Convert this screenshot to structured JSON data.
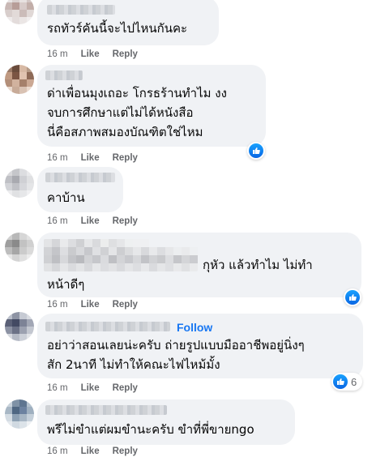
{
  "comments": [
    {
      "lines": [
        "รถทัวร์คันนี้จะไปไหนกันคะ"
      ],
      "time": "16 m",
      "like": "Like",
      "reply": "Reply"
    },
    {
      "lines": [
        "ด่าเพื่อนมุงเถอะ โกรธร้านทำไม งง",
        "จบการศึกษาแต่ไม่ได้หนังสือ",
        "นี่คือสภาพสมองบัณฑิตใช่ไหม"
      ],
      "time": "16 m",
      "like": "Like",
      "reply": "Reply",
      "reaction": {
        "icon": "like-icon"
      }
    },
    {
      "lines": [
        "คาบ้าน"
      ],
      "time": "16 m",
      "like": "Like",
      "reply": "Reply"
    },
    {
      "lines": [
        "กุหัว แล้วทำไม ไม่ทำ",
        "หน้าดีๆ"
      ],
      "time": "16 m",
      "like": "Like",
      "reply": "Reply",
      "reaction": {
        "icon": "like-icon"
      }
    },
    {
      "follow": "Follow",
      "lines": [
        "อย่าว่าสอนเลยน่ะครับ ถ่ายรูปแบบมืออาชีพอยู่นิ่งๆ",
        "สัก 2นาที ไม่ทำให้คณะไฟไหม้มั้ง"
      ],
      "time": "16 m",
      "like": "Like",
      "reply": "Reply",
      "reaction": {
        "icon": "like-icon",
        "count": "6"
      }
    },
    {
      "lines": [
        "พรีไม่ขำแต่ผมขำนะครับ ขำที่พี่ขายngo"
      ],
      "time": "16 m",
      "like": "Like",
      "reply": "Reply"
    }
  ],
  "colors": {
    "bubble": "#f0f2f5",
    "meta": "#65676b",
    "accent": "#1877f2"
  }
}
